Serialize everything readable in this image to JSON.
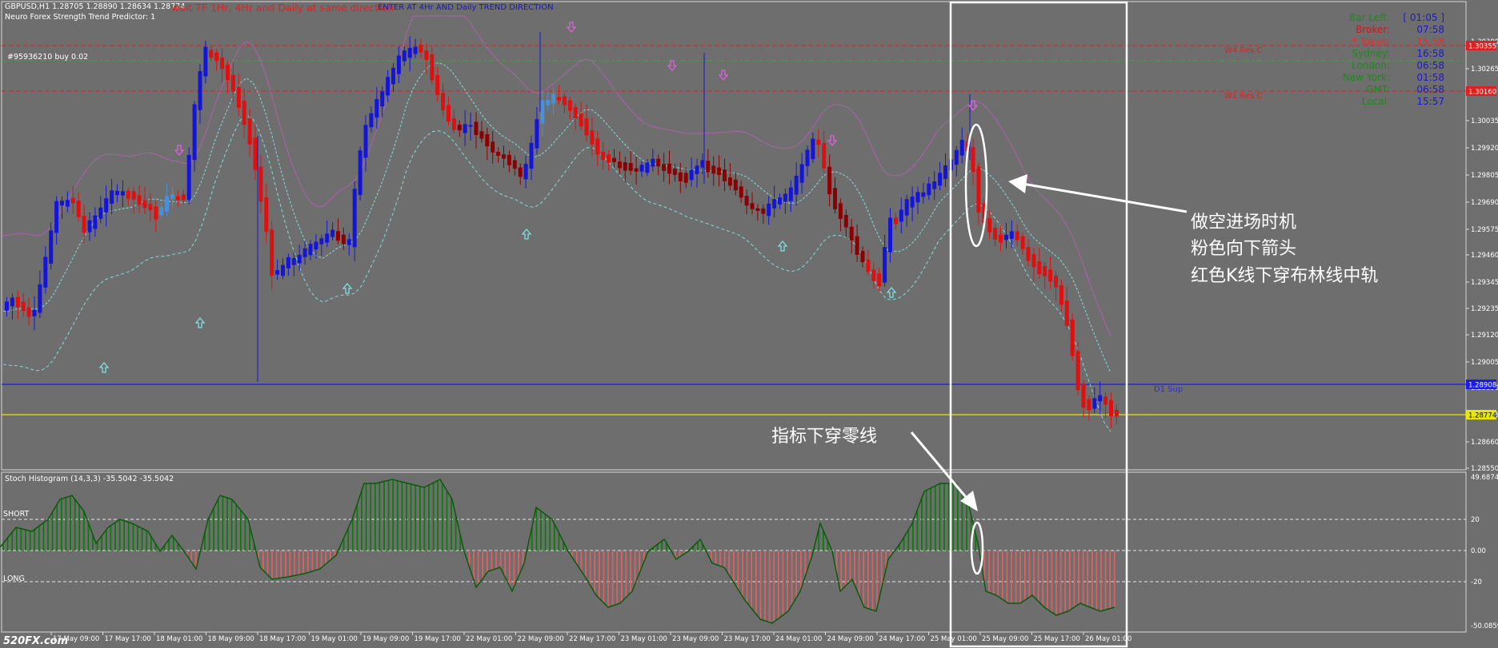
{
  "header": {
    "symbol_info": "GBPUSD,H1  1.28705 1.28890 1.28634 1.28774",
    "indicator_name": "Neuro Forex Strength Trend Predictor: 1",
    "wait_msg": "wait TF 1Hr, 4Hr and Daily at same direction",
    "enter_msg": "ENTER AT 4Hr AND Daily TREND DIRECTION",
    "order_label": "#95936210 buy 0.02"
  },
  "info_panel": [
    {
      "label": "Bar Left:",
      "value": "[ 01:05 ]",
      "color": "#1a8a1a",
      "value_color": "#1a1acc"
    },
    {
      "label": "Broker:",
      "value": "07:58",
      "color": "#cc1a1a",
      "value_color": "#1a1acc"
    },
    {
      "label": "* Tokyo:",
      "value": "15:58",
      "color": "#ff2222",
      "value_color": "#ff2222"
    },
    {
      "label": "Sydney:",
      "value": "16:58",
      "color": "#1a8a1a",
      "value_color": "#1a1acc"
    },
    {
      "label": "London:",
      "value": "06:58",
      "color": "#1a8a1a",
      "value_color": "#1a1acc"
    },
    {
      "label": "New York:",
      "value": "01:58",
      "color": "#1a8a1a",
      "value_color": "#1a1acc"
    },
    {
      "label": "GMT:",
      "value": "06:58",
      "color": "#1a8a1a",
      "value_color": "#1a1acc"
    },
    {
      "label": "Local:",
      "value": "15:57",
      "color": "#1a8a1a",
      "value_color": "#1a1acc"
    }
  ],
  "levels": {
    "w4_label": "W4 Res C",
    "w1_label": "W1 Res C",
    "d1_label": "D1 Sup"
  },
  "price_axis": {
    "ticks": [
      "1.30390",
      "1.30265",
      "1.30035",
      "1.29920",
      "1.29805",
      "1.29690",
      "1.29575",
      "1.29460",
      "1.29345",
      "1.29235",
      "1.29120",
      "1.29005",
      "1.28890",
      "1.28775",
      "1.28660",
      "1.28550"
    ],
    "tag_w4": "1.30355",
    "tag_w1": "1.30160",
    "tag_d1": "1.28908",
    "tag_current": "1.28774"
  },
  "sub_panel": {
    "title": "Stoch Histogram (14,3,3) -35.5042 -35.5042",
    "short_label": "SHORT",
    "long_label": "LONG",
    "ticks": [
      "49.6874",
      "20",
      "0.00",
      "-20",
      "-50.0859"
    ]
  },
  "time_axis": [
    "17 May 09:00",
    "17 May 17:00",
    "18 May 01:00",
    "18 May 09:00",
    "18 May 17:00",
    "19 May 01:00",
    "19 May 09:00",
    "19 May 17:00",
    "22 May 01:00",
    "22 May 09:00",
    "22 May 17:00",
    "23 May 01:00",
    "23 May 09:00",
    "23 May 17:00",
    "24 May 01:00",
    "24 May 09:00",
    "24 May 17:00",
    "25 May 01:00",
    "25 May 09:00",
    "25 May 17:00",
    "26 May 01:00"
  ],
  "annotations": {
    "entry_line1": "做空进场时机",
    "entry_line2": "粉色向下箭头",
    "entry_line3": "红色K线下穿布林线中轨",
    "indicator_note": "指标下穿零线"
  },
  "watermark": "520FX.com",
  "colors": {
    "bg": "#6e6e6e",
    "bull": "#1515d8",
    "bull_light": "#4a90d9",
    "bear": "#e01010",
    "bear_dark": "#8b0000",
    "boll_mid": "#7fd3d3",
    "boll_upper": "#c060c0",
    "hist_green": "#0f7a0f",
    "hist_red": "#e06060",
    "d1_line": "#1a1aee",
    "current_line": "#e8e800"
  }
}
